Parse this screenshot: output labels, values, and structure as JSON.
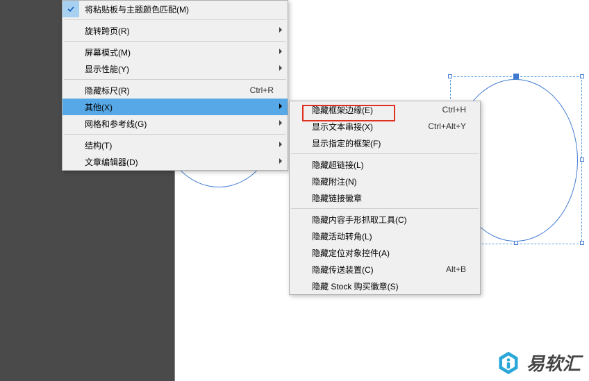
{
  "menu_left": {
    "items": [
      {
        "label": "将粘贴板与主题颜色匹配(M)",
        "checked": true
      },
      {
        "sep": true
      },
      {
        "label": "旋转跨页(R)",
        "submenu": true
      },
      {
        "sep": true
      },
      {
        "label": "屏幕模式(M)",
        "submenu": true
      },
      {
        "label": "显示性能(Y)",
        "submenu": true
      },
      {
        "sep": true
      },
      {
        "label": "隐藏标尺(R)",
        "shortcut": "Ctrl+R"
      },
      {
        "label": "其他(X)",
        "submenu": true,
        "highlight": true
      },
      {
        "label": "网格和参考线(G)",
        "submenu": true
      },
      {
        "sep": true
      },
      {
        "label": "结构(T)",
        "submenu": true
      },
      {
        "label": "文章编辑器(D)",
        "submenu": true
      }
    ]
  },
  "menu_right": {
    "items": [
      {
        "label": "隐藏框架边缘(E)",
        "shortcut": "Ctrl+H",
        "boxed": true
      },
      {
        "label": "显示文本串接(X)",
        "shortcut": "Ctrl+Alt+Y"
      },
      {
        "label": "显示指定的框架(F)"
      },
      {
        "sep": true
      },
      {
        "label": "隐藏超链接(L)"
      },
      {
        "label": "隐藏附注(N)"
      },
      {
        "label": "隐藏链接徽章"
      },
      {
        "sep": true
      },
      {
        "label": "隐藏内容手形抓取工具(C)"
      },
      {
        "label": "隐藏活动转角(L)"
      },
      {
        "label": "隐藏定位对象控件(A)"
      },
      {
        "label": "隐藏传送装置(C)",
        "shortcut": "Alt+B"
      },
      {
        "label": "隐藏 Stock 购买徽章(S)"
      }
    ]
  },
  "watermark": {
    "text": "易软汇"
  }
}
